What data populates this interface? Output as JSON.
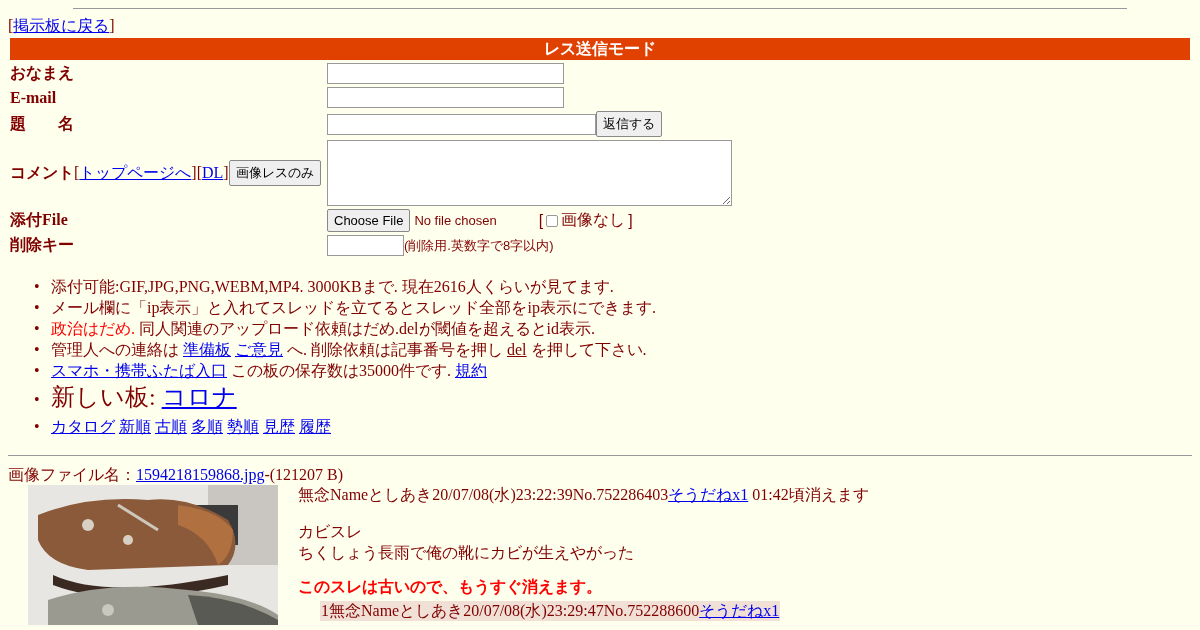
{
  "back_link": {
    "open": "[",
    "label": "掲示板に戻る",
    "close": "]"
  },
  "form": {
    "title": "レス送信モード",
    "name_label": "おなまえ",
    "email_label": "E-mail",
    "subject_label": "題　　名",
    "submit_button": "返信する",
    "comment_label": "コメント",
    "comment_links": [
      {
        "open": "[",
        "label": "トップページへ",
        "close": "]"
      },
      {
        "open": "[",
        "label": "DL",
        "close": "]"
      }
    ],
    "image_only_button": "画像レスのみ",
    "file_label": "添付File",
    "file_button": "Choose File",
    "file_status": "No file chosen",
    "no_image": {
      "open": "[",
      "label": "画像なし",
      "close": "]",
      "checked": false
    },
    "delete_key_label": "削除キー",
    "delete_key_note": "(削除用.英数字で8字以内)"
  },
  "notes": [
    {
      "bullet": "•",
      "large": false,
      "parts": [
        {
          "kind": "text",
          "text": "添付可能:GIF,JPG,PNG,WEBM,MP4. 3000KBまで. 現在2616人くらいが見てます."
        }
      ]
    },
    {
      "bullet": "•",
      "large": false,
      "parts": [
        {
          "kind": "text",
          "text": "メール欄に「ip表示」と入れてスレッドを立てるとスレッド全部をip表示にできます."
        }
      ]
    },
    {
      "bullet": "•",
      "large": false,
      "parts": [
        {
          "kind": "warn",
          "text": "政治はだめ."
        },
        {
          "kind": "text",
          "text": "同人関連のアップロード依頼はだめ.delが閾値を超えるとid表示."
        }
      ]
    },
    {
      "bullet": "•",
      "large": false,
      "parts": [
        {
          "kind": "text",
          "text": "管理人への連絡は"
        },
        {
          "kind": "link",
          "text": "準備板"
        },
        {
          "kind": "link",
          "text": "ご意見"
        },
        {
          "kind": "text",
          "text": "へ. 削除依頼は記事番号を押し"
        },
        {
          "kind": "underline",
          "text": "del"
        },
        {
          "kind": "text",
          "text": "を押して下さい."
        }
      ]
    },
    {
      "bullet": "•",
      "large": false,
      "parts": [
        {
          "kind": "link",
          "text": "スマホ・携帯ふたば入口"
        },
        {
          "kind": "text",
          "text": "この板の保存数は35000件です."
        },
        {
          "kind": "link",
          "text": "規約"
        }
      ]
    },
    {
      "bullet": "•",
      "large": true,
      "parts": [
        {
          "kind": "text",
          "text": "新しい板:"
        },
        {
          "kind": "link",
          "text": "コロナ"
        }
      ]
    },
    {
      "bullet": "•",
      "large": false,
      "parts": [
        {
          "kind": "link",
          "text": "カタログ"
        },
        {
          "kind": "link",
          "text": "新順"
        },
        {
          "kind": "link",
          "text": "古順"
        },
        {
          "kind": "link",
          "text": "多順"
        },
        {
          "kind": "link",
          "text": "勢順"
        },
        {
          "kind": "link",
          "text": "見歴"
        },
        {
          "kind": "link",
          "text": "履歴"
        }
      ]
    }
  ],
  "thread": {
    "file_label": "画像ファイル名：",
    "file_link": "1594218159868.jpg",
    "file_size": "-(121207 B)",
    "image": {
      "kind": "picture"
    },
    "header": "無念Nameとしあき20/07/08(水)23:22:39No.752286403",
    "like_link": "そうだねx1",
    "expiry": "01:42頃消えます",
    "body": [
      "カビスレ",
      "ちくしょう長雨で俺の靴にカビが生えやがった"
    ],
    "warning": "このスレは古いので、もうすぐ消えます。",
    "replies": [
      {
        "header": "1無念Nameとしあき20/07/08(水)23:29:47No.752288600",
        "like_link": "そうだねx1"
      }
    ]
  }
}
